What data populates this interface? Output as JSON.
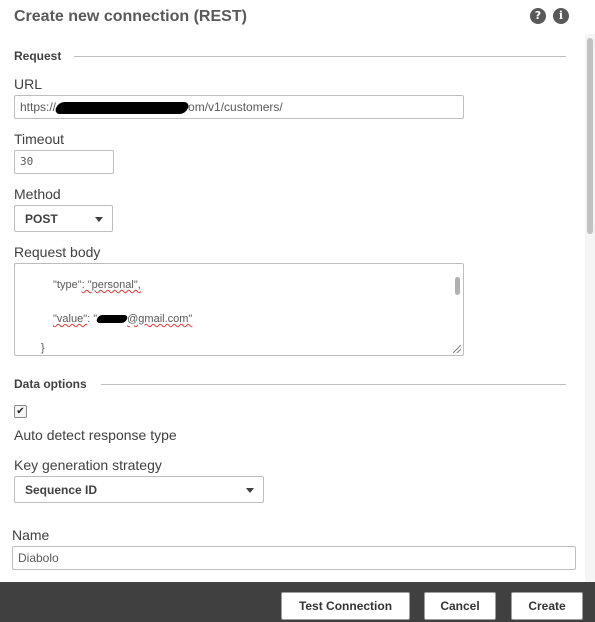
{
  "dialog": {
    "title": "Create new connection (REST)",
    "help_icon": "?",
    "info_icon": "i"
  },
  "request": {
    "section_label": "Request",
    "url_label": "URL",
    "url_prefix": "https://",
    "url_suffix": "om/v1/customers/",
    "timeout_label": "Timeout",
    "timeout_value": "30",
    "method_label": "Method",
    "method_value": "POST",
    "body_label": "Request body",
    "body_line1_key": "\"type\"",
    "body_line1_rest": ": \"personal\",",
    "body_line2_key": "\"value\"",
    "body_line2_mid": ": \"",
    "body_line2_rest": "@gmail.com\"",
    "body_line3": "}"
  },
  "data_options": {
    "section_label": "Data options",
    "auto_detect_label": "Auto detect response type",
    "auto_detect_checked": true,
    "key_strategy_label": "Key generation strategy",
    "key_strategy_value": "Sequence ID"
  },
  "name": {
    "label": "Name",
    "value": "Diabolo"
  },
  "footer": {
    "test_label": "Test Connection",
    "cancel_label": "Cancel",
    "create_label": "Create"
  }
}
